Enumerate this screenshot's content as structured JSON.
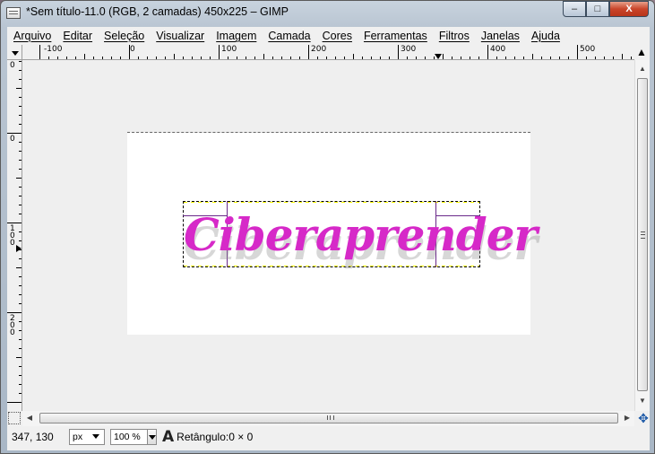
{
  "window": {
    "title": "*Sem título-11.0 (RGB, 2 camadas) 450x225 – GIMP",
    "minimize_label": "–",
    "maximize_label": "□",
    "close_label": "X"
  },
  "menubar": {
    "items": [
      "Arquivo",
      "Editar",
      "Seleção",
      "Visualizar",
      "Imagem",
      "Camada",
      "Cores",
      "Ferramentas",
      "Filtros",
      "Janelas",
      "Ajuda"
    ]
  },
  "rulers": {
    "horizontal_labels": [
      "-100",
      "0",
      "100",
      "200",
      "300",
      "400",
      "500"
    ],
    "vertical_labels": [
      "0",
      "100",
      "200"
    ],
    "vertical_top_label": "0"
  },
  "canvas": {
    "image_text": "Ciberaprender",
    "text_color": "#d629c8"
  },
  "icons": {
    "quick_mask": "quick-mask-icon",
    "navigate": "navigate-icon",
    "text_tool": "text-tool-icon"
  },
  "statusbar": {
    "coordinates": "347, 130",
    "unit": "px",
    "zoom": "100 %",
    "tool_icon_glyph": "A",
    "message": "Retângulo:0 × 0"
  }
}
